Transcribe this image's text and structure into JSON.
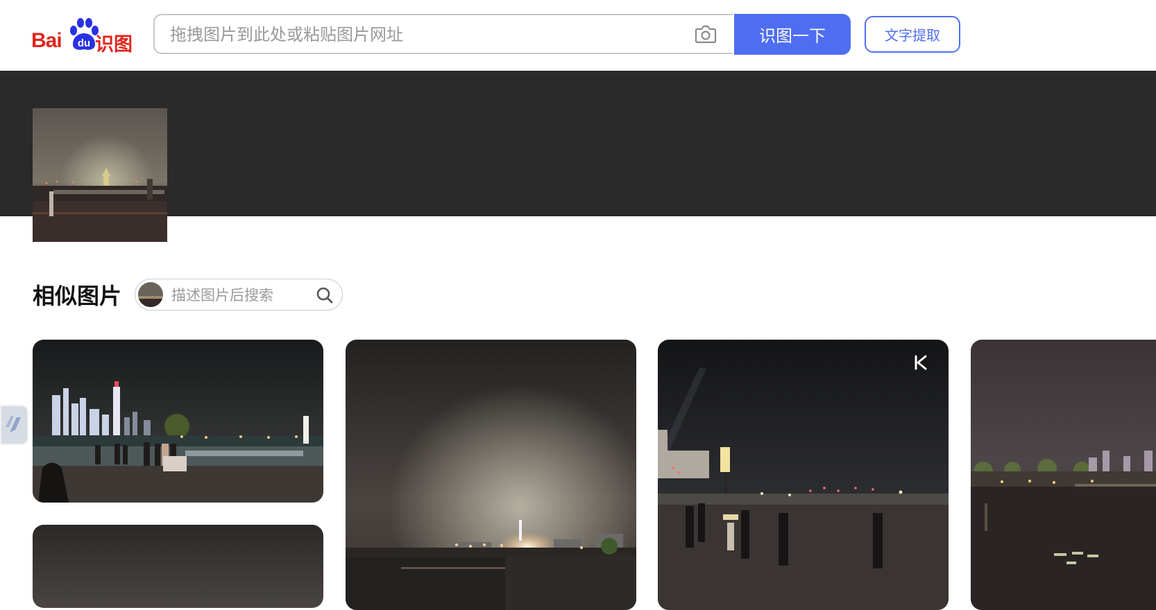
{
  "header": {
    "logo_bai": "Bai",
    "logo_du": "du",
    "logo_shitu": "识图",
    "search_placeholder": "拖拽图片到此处或粘贴图片网址",
    "search_button": "识图一下",
    "text_extract_button": "文字提取"
  },
  "colors": {
    "brand_red": "#e0261e",
    "brand_blue": "#4e6ef2",
    "band_dark": "#2a2a2a"
  },
  "section": {
    "title": "相似图片",
    "describe_placeholder": "描述图片后搜索"
  },
  "results": [
    {
      "name": "night-riverside-city-skyline"
    },
    {
      "name": "night-foggy-river-lights"
    },
    {
      "name": "night-plaza-lamp-crowd",
      "badge_icon": "k-logo-icon"
    },
    {
      "name": "night-lake-reflection"
    },
    {
      "name": "night-sky-partial"
    }
  ]
}
